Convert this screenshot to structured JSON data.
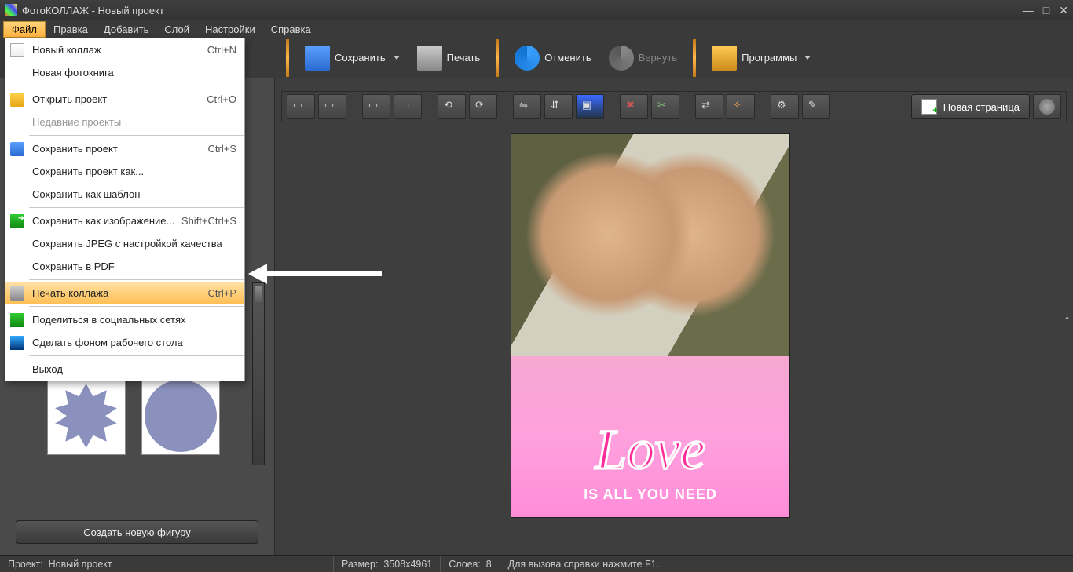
{
  "app": {
    "title": "ФотоКОЛЛАЖ - Новый проект"
  },
  "menubar": {
    "file": "Файл",
    "edit": "Правка",
    "add": "Добавить",
    "layer": "Слой",
    "settings": "Настройки",
    "help": "Справка"
  },
  "file_menu": {
    "new_collage": "Новый коллаж",
    "new_collage_sc": "Ctrl+N",
    "new_photobook": "Новая фотокнига",
    "open_project": "Открыть проект",
    "open_project_sc": "Ctrl+O",
    "recent": "Недавние проекты",
    "save_project": "Сохранить проект",
    "save_project_sc": "Ctrl+S",
    "save_as": "Сохранить проект как...",
    "save_template": "Сохранить как шаблон",
    "save_image": "Сохранить как изображение...",
    "save_image_sc": "Shift+Ctrl+S",
    "save_jpeg": "Сохранить JPEG с настройкой качества",
    "save_pdf": "Сохранить в PDF",
    "print_collage": "Печать коллажа",
    "print_collage_sc": "Ctrl+P",
    "share_social": "Поделиться в социальных сетях",
    "set_wallpaper": "Сделать фоном рабочего стола",
    "exit": "Выход"
  },
  "toolbar": {
    "save": "Сохранить",
    "print": "Печать",
    "undo": "Отменить",
    "redo": "Вернуть",
    "programs": "Программы"
  },
  "toolstrip": {
    "new_page": "Новая страница"
  },
  "sidepanel": {
    "create_shape": "Создать новую фигуру"
  },
  "canvas": {
    "love": "Love",
    "sub": "IS ALL YOU NEED"
  },
  "statusbar": {
    "project_label": "Проект:",
    "project_name": "Новый проект",
    "size_label": "Размер:",
    "size_value": "3508x4961",
    "layers_label": "Слоев:",
    "layers_value": "8",
    "help_hint": "Для вызова справки нажмите F1."
  }
}
